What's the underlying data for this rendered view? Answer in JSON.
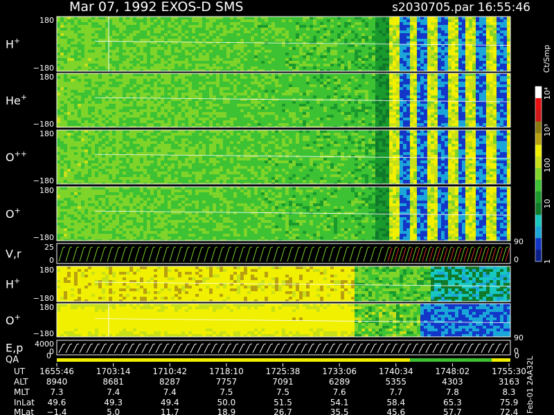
{
  "header": {
    "title": "Mar 07, 1992    EXOS-D SMS",
    "file_time": "s2030705.par  16:55:46"
  },
  "colorbar": {
    "unit_label": "Ct/Smp",
    "ticks": [
      {
        "label": "1",
        "level": 0.0
      },
      {
        "label": "10",
        "level": 0.33
      },
      {
        "label": "100",
        "level": 0.55
      },
      {
        "label": "10³",
        "level": 0.75
      },
      {
        "label": "10⁴",
        "level": 0.96
      }
    ],
    "colors": [
      "#0a1f8a",
      "#1236c8",
      "#1aa6d8",
      "#16c8c0",
      "#0f7a2a",
      "#1a9a2c",
      "#3cc232",
      "#7fd42a",
      "#c8e018",
      "#f0f000",
      "#b8a010",
      "#8a7a10",
      "#d01818",
      "#e81010",
      "#ffffff"
    ]
  },
  "chart_data": {
    "type": "heatmap",
    "panels": [
      {
        "name": "H+",
        "label_main": "H",
        "label_sup": "+",
        "ylim": [
          -180,
          180
        ],
        "tick_top": "180",
        "tick_bottom": "−180"
      },
      {
        "name": "He+",
        "label_main": "He",
        "label_sup": "+",
        "ylim": [
          -180,
          180
        ],
        "tick_top": "180",
        "tick_bottom": "−180"
      },
      {
        "name": "O++",
        "label_main": "O",
        "label_sup": "++",
        "ylim": [
          -180,
          180
        ],
        "tick_top": "180",
        "tick_bottom": "−180"
      },
      {
        "name": "O+",
        "label_main": "O",
        "label_sup": "+",
        "ylim": [
          -180,
          180
        ],
        "tick_top": "180",
        "tick_bottom": "−180",
        "right_tick": "90"
      },
      {
        "name": "V,r",
        "label_main": "V,r",
        "label_sup": "",
        "ylim": [
          0,
          25
        ],
        "tick_top": "25",
        "tick_bottom": "0",
        "right_tick": "0"
      },
      {
        "name": "H+",
        "label_main": "H",
        "label_sup": "+",
        "ylim": [
          -180,
          180
        ],
        "tick_top": "180",
        "tick_bottom": "−180"
      },
      {
        "name": "O+",
        "label_main": "O",
        "label_sup": "+",
        "ylim": [
          -180,
          180
        ],
        "tick_top": "180",
        "tick_bottom": "−180",
        "right_tick": "90"
      },
      {
        "name": "E,p",
        "label_main": "E,p",
        "label_sup": "",
        "ylim": [
          0,
          4000
        ],
        "tick_top": "4000",
        "tick_bottom": "0",
        "right_tick": "0"
      }
    ],
    "qa_label": "QA",
    "qa_tick_left": "0",
    "qa_tick_right": "0",
    "time_axis": {
      "row_labels": [
        "UT",
        "ALT",
        "MLT",
        "InLat",
        "MLat"
      ],
      "columns": [
        {
          "UT": "1655:46",
          "ALT": "8940",
          "MLT": "7.3",
          "InLat": "49.6",
          "MLat": "−1.4"
        },
        {
          "UT": "1703:14",
          "ALT": "8681",
          "MLT": "7.4",
          "InLat": "49.3",
          "MLat": "5.0"
        },
        {
          "UT": "1710:42",
          "ALT": "8287",
          "MLT": "7.4",
          "InLat": "49.4",
          "MLat": "11.7"
        },
        {
          "UT": "1718:10",
          "ALT": "7757",
          "MLT": "7.5",
          "InLat": "50.0",
          "MLat": "18.9"
        },
        {
          "UT": "1725:38",
          "ALT": "7091",
          "MLT": "7.5",
          "InLat": "51.5",
          "MLat": "26.7"
        },
        {
          "UT": "1733:06",
          "ALT": "6289",
          "MLT": "7.6",
          "InLat": "54.1",
          "MLat": "35.5"
        },
        {
          "UT": "1740:34",
          "ALT": "5355",
          "MLT": "7.7",
          "InLat": "58.4",
          "MLat": "45.6"
        },
        {
          "UT": "1748:02",
          "ALT": "4303",
          "MLT": "7.8",
          "InLat": "65.3",
          "MLat": "57.7"
        },
        {
          "UT": "1755:30",
          "ALT": "3163",
          "MLT": "8.3",
          "InLat": "75.9",
          "MLat": "72.4"
        }
      ]
    },
    "side_note": "Feb-01 2AA32L"
  }
}
